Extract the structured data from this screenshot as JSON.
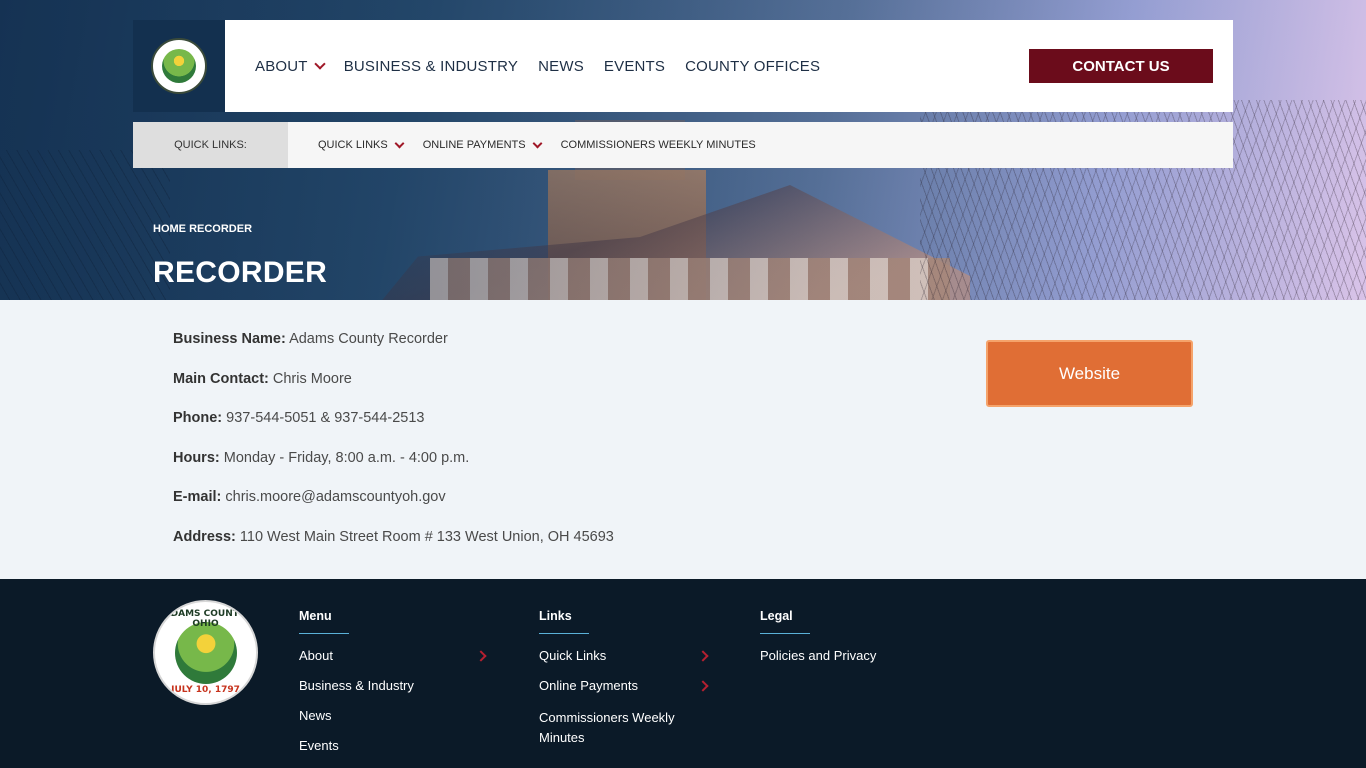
{
  "site": {
    "logo_alt": "Adams County, Ohio seal",
    "seal_top_text": "ADAMS COUNTY, OHIO",
    "seal_bottom_text": "JULY 10, 1797"
  },
  "nav": {
    "items": [
      {
        "label": "ABOUT",
        "has_dropdown": true
      },
      {
        "label": "BUSINESS & INDUSTRY",
        "has_dropdown": false
      },
      {
        "label": "NEWS",
        "has_dropdown": false
      },
      {
        "label": "EVENTS",
        "has_dropdown": false
      },
      {
        "label": "COUNTY OFFICES",
        "has_dropdown": false
      }
    ],
    "contact_label": "CONTACT US"
  },
  "quick_bar": {
    "label": "QUICK LINKS:",
    "items": [
      {
        "label": "QUICK LINKS",
        "has_dropdown": true
      },
      {
        "label": "ONLINE PAYMENTS",
        "has_dropdown": true
      },
      {
        "label": "COMMISSIONERS WEEKLY MINUTES",
        "has_dropdown": false
      }
    ]
  },
  "breadcrumb": {
    "home": "HOME",
    "current": "RECORDER"
  },
  "page_title": "RECORDER",
  "details": [
    {
      "key": "Business Name:",
      "value": "Adams County Recorder"
    },
    {
      "key": "Main Contact:",
      "value": "Chris Moore"
    },
    {
      "key": "Phone:",
      "value": "937-544-5051 & 937-544-2513"
    },
    {
      "key": "Hours:",
      "value": "Monday - Friday, 8:00 a.m. - 4:00 p.m."
    },
    {
      "key": "E-mail:",
      "value": "chris.moore@adamscountyoh.gov"
    },
    {
      "key": "Address:",
      "value": "110 West Main Street Room # 133 West Union, OH 45693"
    }
  ],
  "website_label": "Website",
  "footer": {
    "menu": {
      "heading": "Menu",
      "links": [
        {
          "label": "About",
          "has_submenu": true
        },
        {
          "label": "Business & Industry",
          "has_submenu": false
        },
        {
          "label": "News",
          "has_submenu": false
        },
        {
          "label": "Events",
          "has_submenu": false
        }
      ]
    },
    "links": {
      "heading": "Links",
      "links": [
        {
          "label": "Quick Links",
          "has_submenu": true
        },
        {
          "label": "Online Payments",
          "has_submenu": true
        },
        {
          "label": "Commissioners Weekly Minutes",
          "has_submenu": false
        }
      ]
    },
    "legal": {
      "heading": "Legal",
      "links": [
        {
          "label": "Policies and Privacy",
          "has_submenu": false
        }
      ]
    }
  },
  "colors": {
    "brand_dark": "#13304f",
    "contact_button": "#6b0c1b",
    "website_button": "#e06e35",
    "footer_bg": "#0b1a28",
    "accent_chevron": "#a01828"
  }
}
